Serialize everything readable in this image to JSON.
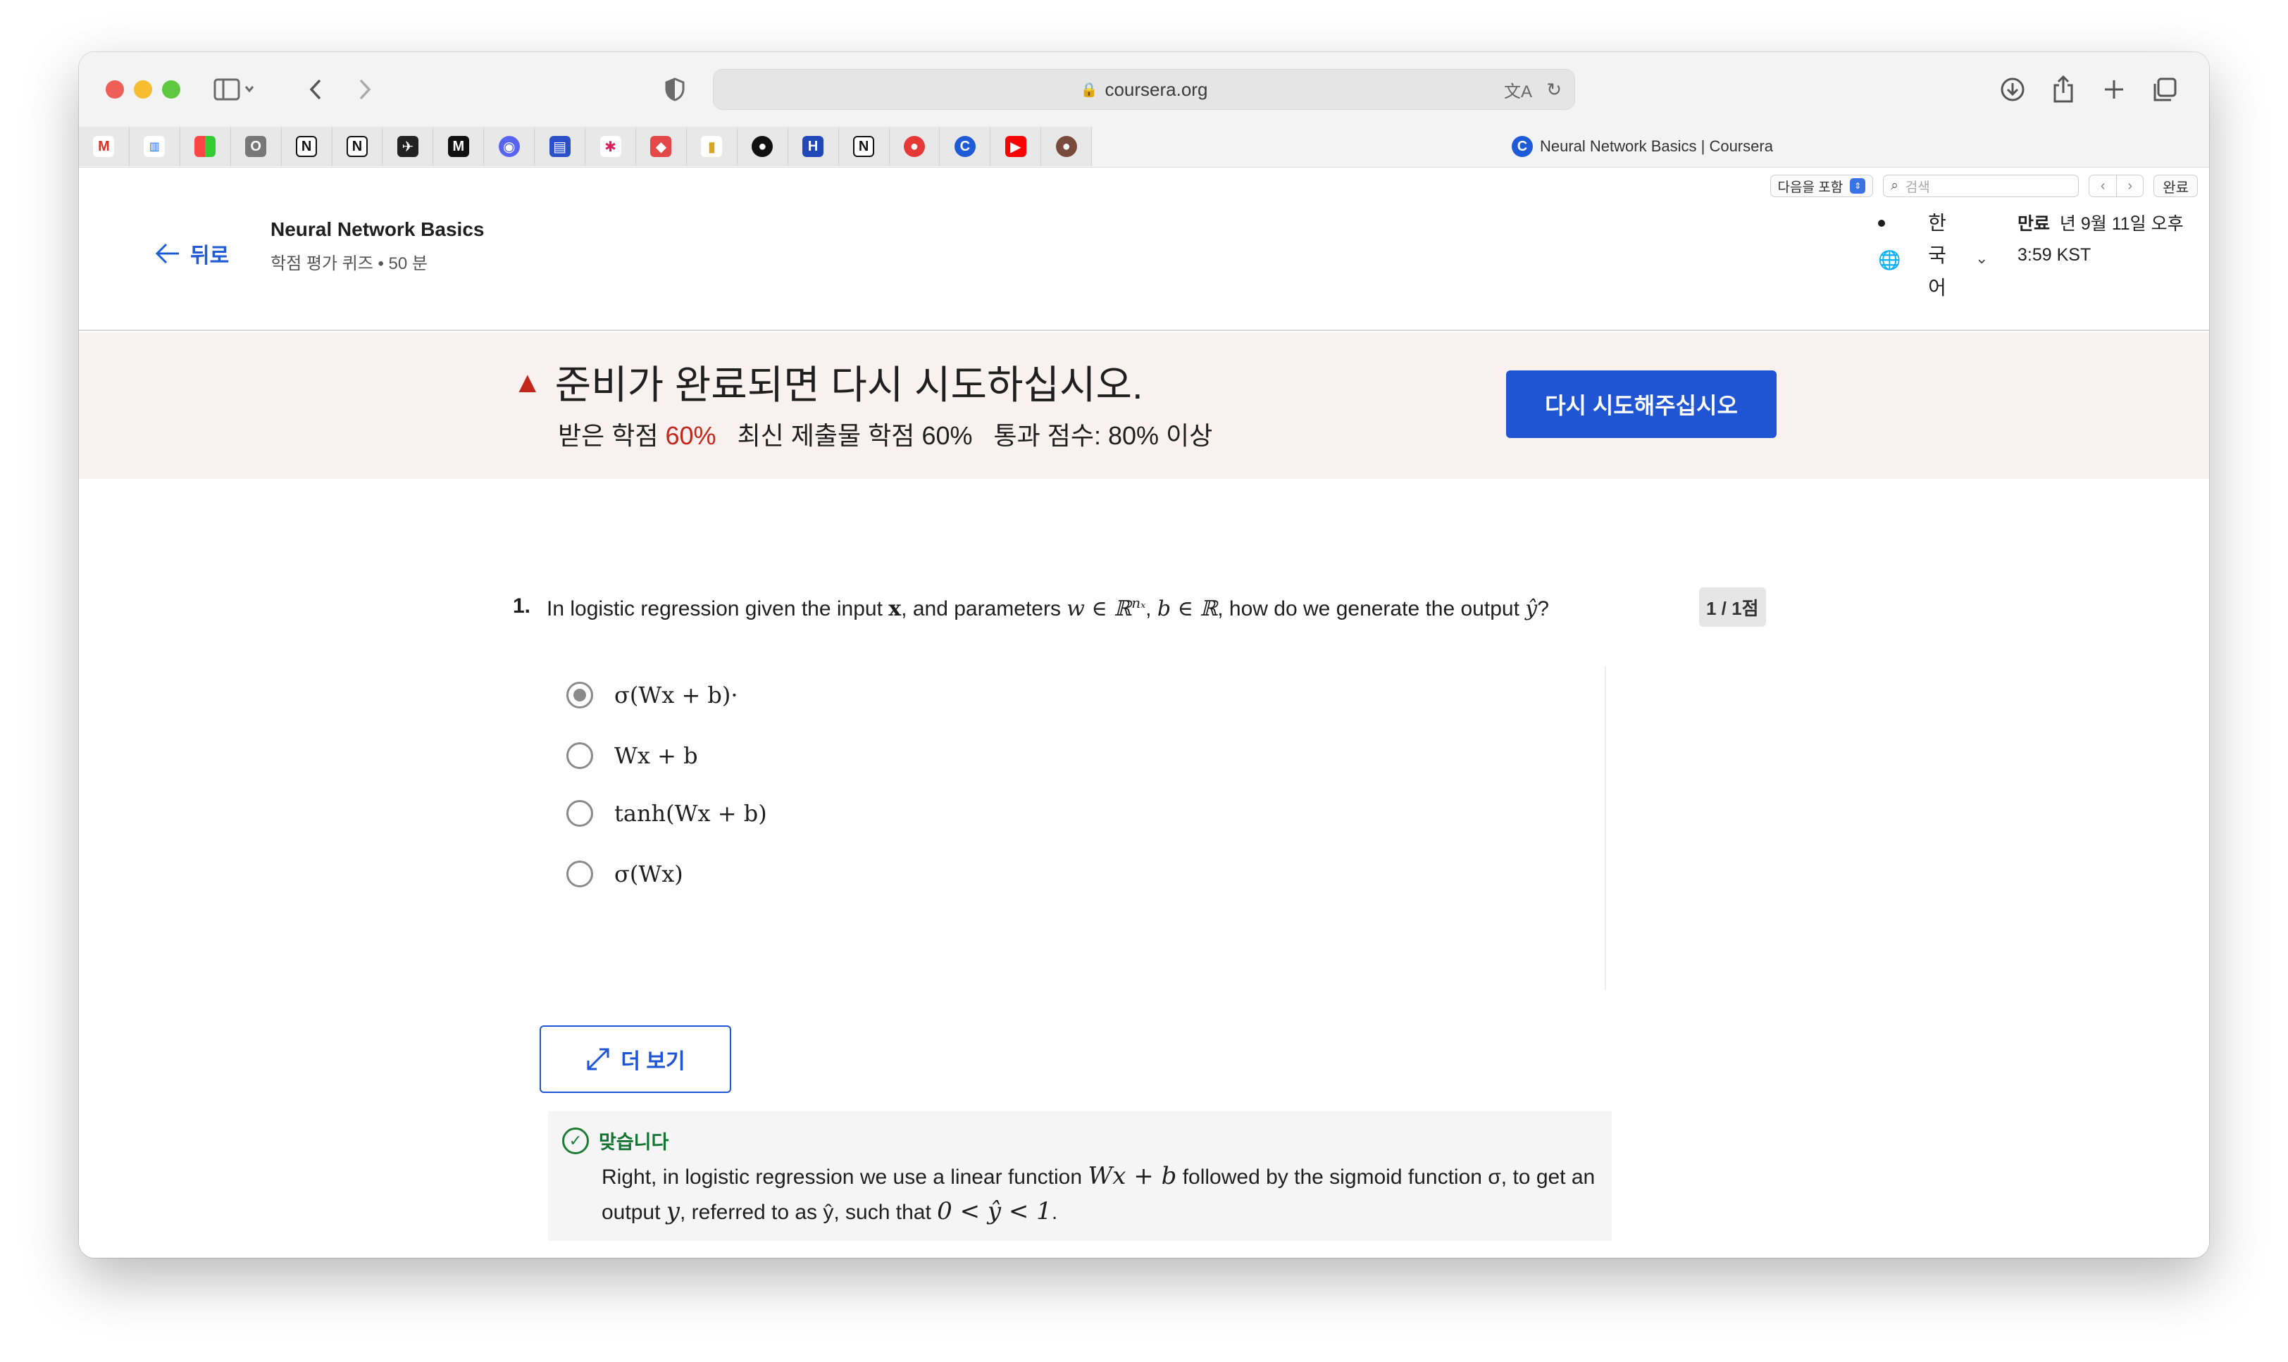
{
  "browser": {
    "url": "coursera.org",
    "tab_title": "Neural Network Basics | Coursera",
    "bookmarks": [
      "gmail-icon",
      "barcode-icon",
      "grid-icon",
      "o-icon",
      "notion-icon",
      "notion-icon",
      "plane-icon",
      "medium-icon",
      "discord-icon",
      "layout-icon",
      "slack-icon",
      "puzzle-icon",
      "tag-icon",
      "github-icon",
      "h-icon",
      "notion-icon",
      "record-icon",
      "coursera-icon",
      "youtube-icon",
      "avatar-icon"
    ]
  },
  "find_bar": {
    "mode": "다음을 포함",
    "placeholder": "검색",
    "done": "완료"
  },
  "header": {
    "back": "뒤로",
    "course_title": "Neural Network Basics",
    "course_sub": "학점 평가 퀴즈 • 50 분",
    "lang_chars": [
      "한",
      "국",
      "어"
    ],
    "due_label": "만료",
    "due_date": "년 9월 11일 오후",
    "due_time": "3:59 KST"
  },
  "banner": {
    "title": "준비가 완료되면 다시 시도하십시오.",
    "received_label": "받은 학점",
    "received_value": "60%",
    "latest_label": "최신 제출물 학점",
    "latest_value": "60%",
    "pass_label": "통과 점수:",
    "pass_value": "80% 이상",
    "retry_button": "다시 시도해주십시오"
  },
  "question": {
    "number": "1.",
    "text_a": "In logistic regression given the input ",
    "text_x": "x",
    "text_b": ", and parameters ",
    "text_w": "w ∈ ℝ",
    "text_nx": "nₓ",
    "text_c": ", ",
    "text_bR": "b ∈ ℝ",
    "text_d": ", how do we generate the output ",
    "text_yhat": "ŷ",
    "text_e": "?",
    "points": "1 / 1점",
    "options": [
      "σ(Wx + b)·",
      "Wx + b",
      "tanh(Wx + b)",
      "σ(Wx)"
    ],
    "selected_index": 0
  },
  "more_button": "더 보기",
  "feedback": {
    "title": "맞습니다",
    "text_a": "Right, in logistic regression we use a linear function ",
    "math_a": "Wx + b",
    "text_b": " followed by the sigmoid function σ, to get an output ",
    "math_b": "y",
    "text_c": ", referred to as ŷ, such that ",
    "math_c": "0 < ŷ < 1",
    "text_d": "."
  }
}
